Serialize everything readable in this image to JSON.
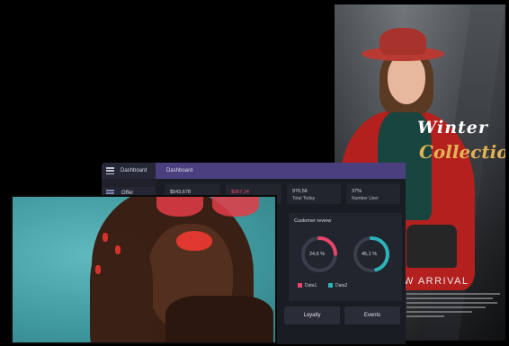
{
  "poster": {
    "script_line1": "Winter",
    "script_line2": "Collection",
    "arrival_text": "W ARRIVAL"
  },
  "dashboard": {
    "sidebar_title": "Dashboard",
    "header_title": "Dashboard",
    "sidebar_items": [
      {
        "label": "Offer"
      }
    ],
    "stats": [
      {
        "value": "$543,678",
        "label": ""
      },
      {
        "value": "$987,34",
        "label": ""
      },
      {
        "value": "976,56",
        "label": "Total Today"
      },
      {
        "value": "37%",
        "label": "Number User"
      }
    ],
    "customer_review": {
      "title": "Customer review",
      "donut1_value": "24,6 %",
      "donut2_value": "45,1 %",
      "legend": [
        {
          "label": "Data1",
          "color": "#e8456b"
        },
        {
          "label": "Data2",
          "color": "#2bb3b8"
        }
      ]
    },
    "buttons": {
      "loyalty": "Loyalty",
      "events": "Events"
    }
  },
  "colors": {
    "accent_purple": "#4b3f80",
    "accent_pink": "#e8456b",
    "accent_teal": "#2bb3b8"
  },
  "chart_data": {
    "type": "pie",
    "title": "Customer review",
    "series": [
      {
        "name": "Data1",
        "values": [
          24.6
        ]
      },
      {
        "name": "Data2",
        "values": [
          45.1
        ]
      }
    ]
  }
}
